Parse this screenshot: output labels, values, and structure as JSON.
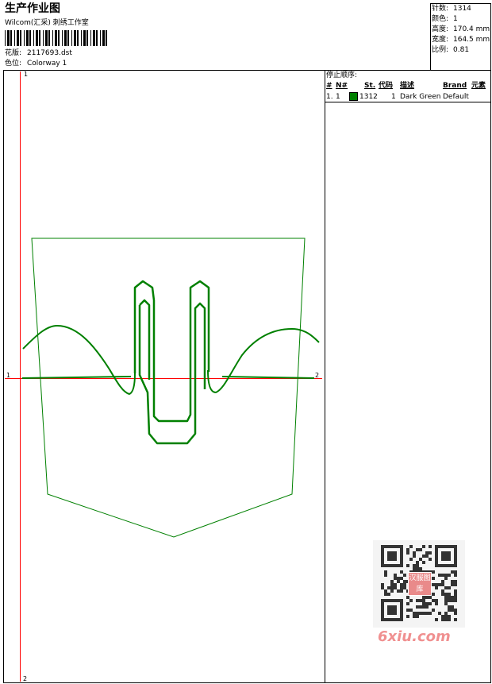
{
  "header": {
    "title": "生产作业图",
    "company": "Wilcom(汇采) 刺绣工作室",
    "design_label": "花版:",
    "design_value": "2117693.dst",
    "colorway_label": "色位:",
    "colorway_value": "Colorway 1"
  },
  "stats": {
    "stitches_label": "针数:",
    "stitches_value": "1314",
    "colors_label": "颜色:",
    "colors_value": "1",
    "height_label": "高度:",
    "height_value": "170.4 mm",
    "width_label": "宽度:",
    "width_value": "164.5 mm",
    "scale_label": "比例:",
    "scale_value": "0.81"
  },
  "sequence": {
    "title": "停止顺序:",
    "columns": [
      "#",
      "N#",
      "St.",
      "代码",
      "描述",
      "Brand",
      "元素"
    ],
    "rows": [
      {
        "index": "1.",
        "n": "1",
        "swatch_color": "#008000",
        "stitches": "1312",
        "code": "1",
        "description": "Dark Green",
        "brand": "Default",
        "element": ""
      }
    ]
  },
  "axes": {
    "top_label": "1",
    "bottom_label": "2",
    "left_label": "1",
    "right_label": "2"
  },
  "watermark": {
    "seal_text": "汉服图库",
    "site": "6xiu.com"
  },
  "colors": {
    "thread": "#008000",
    "axis": "#ff0000",
    "site_text": "#f09090"
  }
}
